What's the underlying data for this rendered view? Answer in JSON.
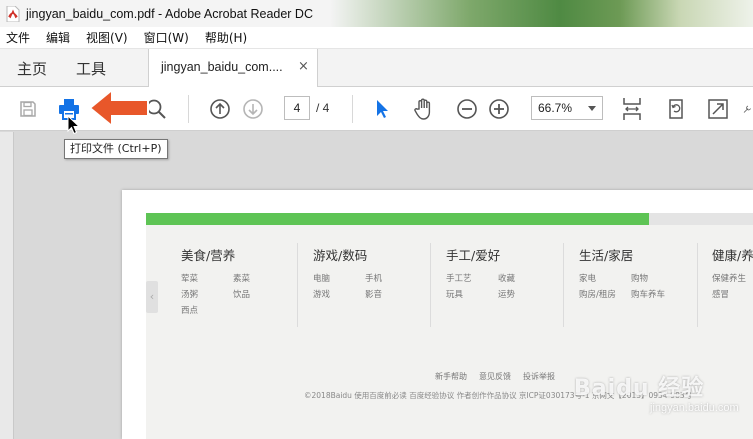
{
  "window": {
    "title": "jingyan_baidu_com.pdf - Adobe Acrobat Reader DC"
  },
  "menu": [
    "文件",
    "编辑",
    "视图(V)",
    "窗口(W)",
    "帮助(H)"
  ],
  "tabs": {
    "home": "主页",
    "tools": "工具",
    "document": "jingyan_baidu_com....",
    "close_glyph": "×"
  },
  "toolbar": {
    "current_page": "4",
    "page_total": "/ 4",
    "zoom": "66.7%"
  },
  "tooltip": "打印文件 (Ctrl+P)",
  "document": {
    "categories": [
      {
        "title": "美食/营养",
        "items": [
          "荤菜",
          "素菜",
          "汤粥",
          "饮品",
          "西点"
        ]
      },
      {
        "title": "游戏/数码",
        "items": [
          "电脑",
          "手机",
          "游戏",
          "影音"
        ]
      },
      {
        "title": "手工/爱好",
        "items": [
          "手工艺",
          "收藏",
          "玩具",
          "运势"
        ]
      },
      {
        "title": "生活/家居",
        "items": [
          "家电",
          "购物",
          "购房/租房",
          "购车养车"
        ]
      },
      {
        "title": "健康/养",
        "items": [
          "保健养生",
          "感冒"
        ]
      }
    ],
    "footer_links": [
      "新手帮助",
      "意见反馈",
      "投诉举报"
    ],
    "footer_copy": "©2018Baidu  使用百度前必读  百度经验协议  作者创作作品协议  京ICP证030173号-1 京网文【2013】0934-983号"
  },
  "watermark": {
    "main": "Baidu 经验",
    "sub": "jingyan.baidu.com"
  },
  "colors": {
    "accent_blue": "#1473e6",
    "annotation_orange": "#e8572a",
    "progress_green": "#5ec455"
  }
}
